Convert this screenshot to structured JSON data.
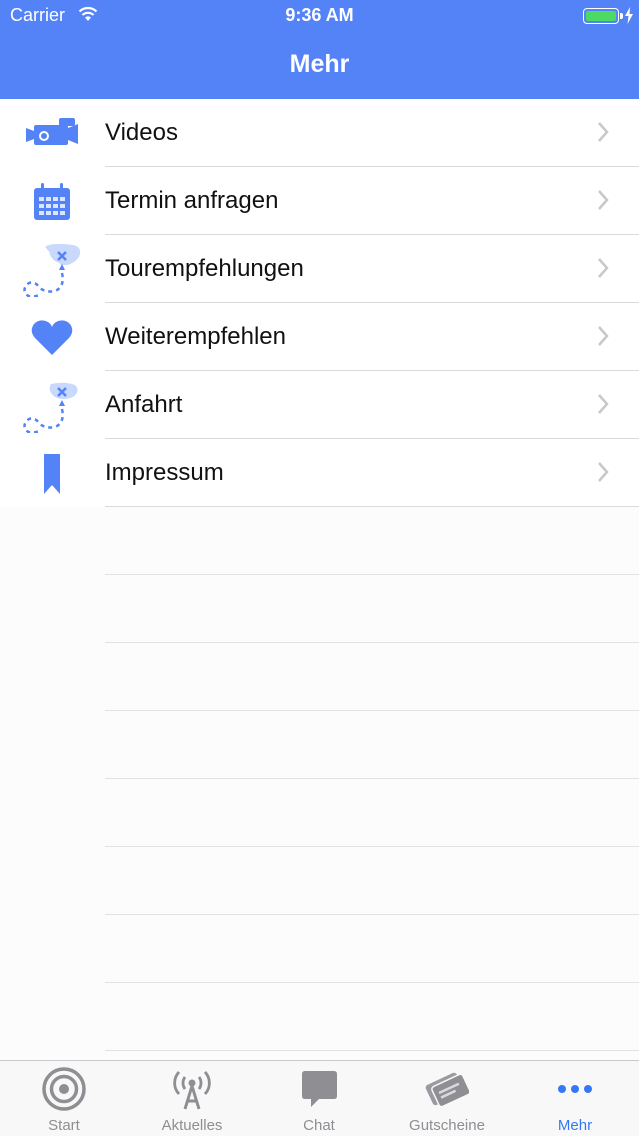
{
  "status_bar": {
    "carrier": "Carrier",
    "time": "9:36 AM"
  },
  "nav": {
    "title": "Mehr"
  },
  "colors": {
    "accent": "#5383f7",
    "tab_active": "#3478f6",
    "tab_inactive": "#8e8e93",
    "battery": "#4cd964"
  },
  "menu": {
    "items": [
      {
        "label": "Videos",
        "icon": "video-camera-icon"
      },
      {
        "label": "Termin anfragen",
        "icon": "calendar-icon"
      },
      {
        "label": "Tourempfehlungen",
        "icon": "route-map-icon"
      },
      {
        "label": "Weiterempfehlen",
        "icon": "heart-icon"
      },
      {
        "label": "Anfahrt",
        "icon": "route-map-icon"
      },
      {
        "label": "Impressum",
        "icon": "bookmark-icon"
      }
    ]
  },
  "tabbar": {
    "tabs": [
      {
        "label": "Start",
        "icon": "target-icon"
      },
      {
        "label": "Aktuelles",
        "icon": "antenna-icon"
      },
      {
        "label": "Chat",
        "icon": "chat-bubble-icon"
      },
      {
        "label": "Gutscheine",
        "icon": "gift-card-icon"
      },
      {
        "label": "Mehr",
        "icon": "more-dots-icon",
        "active": true
      }
    ]
  }
}
